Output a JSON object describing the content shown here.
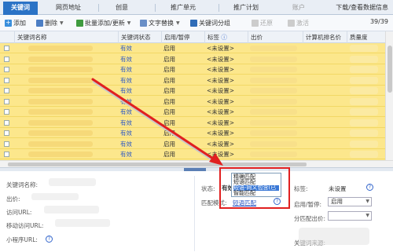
{
  "tabs": [
    {
      "label": "关键词",
      "active": true
    },
    {
      "label": "网页地址",
      "active": false
    },
    {
      "label": "创意",
      "active": false
    },
    {
      "label": "推广单元",
      "active": false
    },
    {
      "label": "推广计划",
      "active": false
    },
    {
      "label": "账户",
      "disabled": true
    }
  ],
  "tab_right": "下载/查看数据信息",
  "toolbar": {
    "add": "添加",
    "delete": "删除",
    "bulk_add": "批量添加/更新",
    "text_replace": "文字替换",
    "keyword_group": "关键词分组",
    "restore": "还原",
    "activate": "激活",
    "count": "39/39"
  },
  "columns": [
    "关键词名称",
    "关键词状态",
    "启用/暂停",
    "标签",
    "出价",
    "计算机排名价",
    "质量度"
  ],
  "rows": [
    {
      "status": "有效",
      "enable": "启用",
      "tag": "<未设置>"
    },
    {
      "status": "有效",
      "enable": "启用",
      "tag": "<未设置>"
    },
    {
      "status": "有效",
      "enable": "启用",
      "tag": "<未设置>"
    },
    {
      "status": "有效",
      "enable": "启用",
      "tag": "<未设置>"
    },
    {
      "status": "有效",
      "enable": "启用",
      "tag": "<未设置>"
    },
    {
      "status": "有效",
      "enable": "启用",
      "tag": "<未设置>"
    },
    {
      "status": "有效",
      "enable": "启用",
      "tag": "<未设置>"
    },
    {
      "status": "有效",
      "enable": "启用",
      "tag": "<未设置>"
    },
    {
      "status": "有效",
      "enable": "启用",
      "tag": "<未设置>"
    },
    {
      "status": "有效",
      "enable": "启用",
      "tag": "<未设置>"
    },
    {
      "status": "有效",
      "enable": "启用",
      "tag": "<未设置>"
    }
  ],
  "detail": {
    "keyword_name_label": "关键词名称:",
    "bid_label": "出价:",
    "visit_url_label": "访问URL:",
    "mobile_url_label": "移动访问URL:",
    "mini_url_label": "小程序URL:",
    "status_label": "状态:",
    "status_value": "有效",
    "match_label": "匹配模式:",
    "match_value": "短语匹配",
    "tag_label": "标签:",
    "tag_value": "未设置",
    "enable_label": "启用/暂停:",
    "enable_value": "启用",
    "bid_split_label": "分匹配出价:",
    "bid_split_value": "",
    "source_label": "关键词来源:"
  },
  "match_options": [
    {
      "label": "精确匹配",
      "selected": false
    },
    {
      "label": "短语匹配",
      "selected": false
    },
    {
      "label": "短语-同义包含(已合并)",
      "selected": true
    },
    {
      "label": "智能匹配",
      "selected": false
    }
  ],
  "colors": {
    "tab_active": "#2b73c6",
    "row_highlight": "#fce78c",
    "status_text": "#2b57c4",
    "callout_red": "#e02020"
  }
}
